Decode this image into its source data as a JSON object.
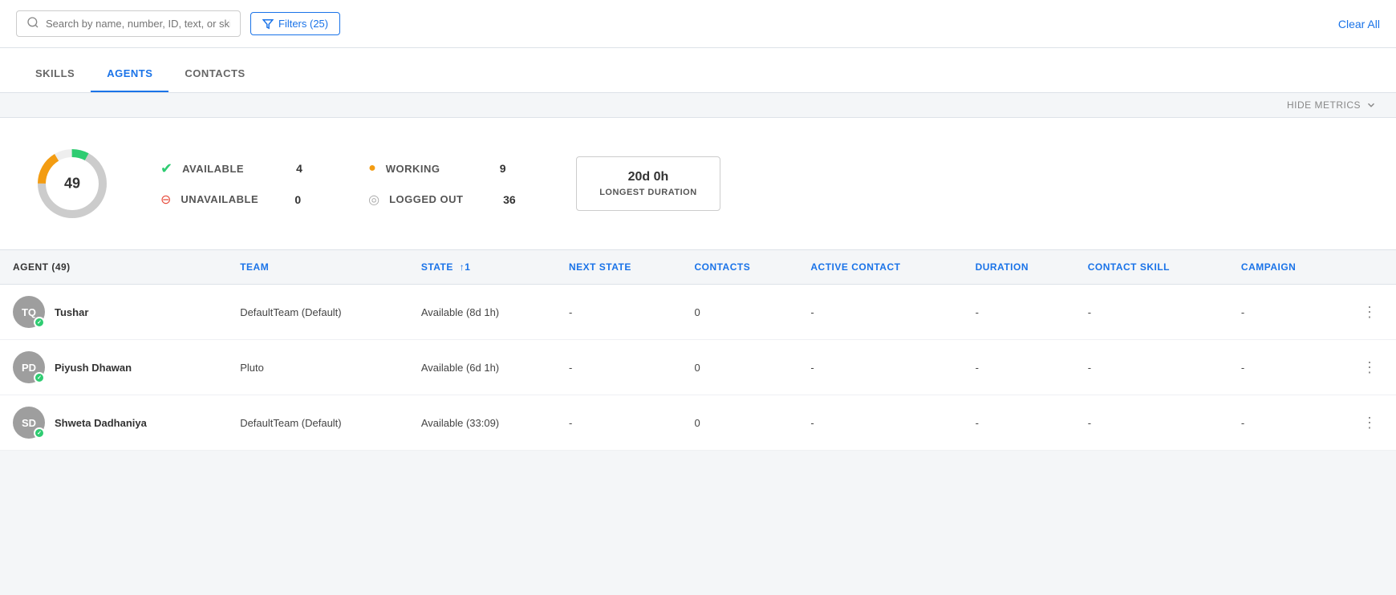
{
  "topbar": {
    "search_placeholder": "Search by name, number, ID, text, or skill",
    "filter_label": "Filters (25)",
    "clear_all_label": "Clear All"
  },
  "tabs": [
    {
      "id": "skills",
      "label": "SKILLS",
      "active": false
    },
    {
      "id": "agents",
      "label": "AGENTS",
      "active": true
    },
    {
      "id": "contacts",
      "label": "CONTACTS",
      "active": false
    }
  ],
  "metrics_toggle": "HIDE METRICS",
  "metrics": {
    "donut_value": "49",
    "stats": [
      {
        "id": "available",
        "dot_type": "green",
        "label": "AVAILABLE",
        "value": "4"
      },
      {
        "id": "unavailable",
        "dot_type": "red",
        "label": "UNAVAILABLE",
        "value": "0"
      },
      {
        "id": "working",
        "dot_type": "yellow",
        "label": "WORKING",
        "value": "9"
      },
      {
        "id": "logged_out",
        "dot_type": "gray",
        "label": "LOGGED OUT",
        "value": "36"
      }
    ],
    "longest_duration_value": "20d 0h",
    "longest_duration_label": "LONGEST DURATION"
  },
  "table": {
    "columns": [
      {
        "id": "agent",
        "label": "AGENT (49)",
        "color": "dark"
      },
      {
        "id": "team",
        "label": "TEAM",
        "color": "blue"
      },
      {
        "id": "state",
        "label": "STATE",
        "color": "blue",
        "sort": "↑1"
      },
      {
        "id": "next_state",
        "label": "NEXT STATE",
        "color": "blue"
      },
      {
        "id": "contacts",
        "label": "CONTACTS",
        "color": "blue"
      },
      {
        "id": "active_contact",
        "label": "ACTIVE CONTACT",
        "color": "blue"
      },
      {
        "id": "duration",
        "label": "DURATION",
        "color": "blue"
      },
      {
        "id": "contact_skill",
        "label": "CONTACT SKILL",
        "color": "blue"
      },
      {
        "id": "campaign",
        "label": "CAMPAIGN",
        "color": "blue"
      }
    ],
    "rows": [
      {
        "initials": "TQ",
        "name": "Tushar",
        "team": "DefaultTeam (Default)",
        "state": "Available (8d 1h)",
        "next_state": "-",
        "contacts": "0",
        "active_contact": "-",
        "duration": "-",
        "contact_skill": "-",
        "campaign": "-",
        "status": "available"
      },
      {
        "initials": "PD",
        "name": "Piyush Dhawan",
        "team": "Pluto",
        "state": "Available (6d 1h)",
        "next_state": "-",
        "contacts": "0",
        "active_contact": "-",
        "duration": "-",
        "contact_skill": "-",
        "campaign": "-",
        "status": "available"
      },
      {
        "initials": "SD",
        "name": "Shweta Dadhaniya",
        "team": "DefaultTeam (Default)",
        "state": "Available (33:09)",
        "next_state": "-",
        "contacts": "0",
        "active_contact": "-",
        "duration": "-",
        "contact_skill": "-",
        "campaign": "-",
        "status": "available"
      }
    ]
  }
}
